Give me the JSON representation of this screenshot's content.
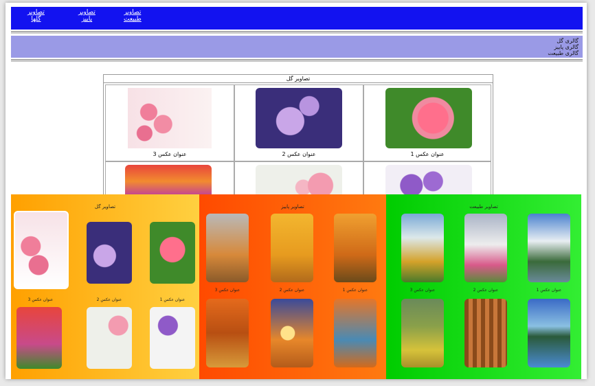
{
  "topnav": {
    "items": [
      {
        "line1": "تصاویر",
        "line2": "گلها"
      },
      {
        "line1": "تصاویر",
        "line2": "پاییز"
      },
      {
        "line1": "تصاویر",
        "line2": "طبیعت"
      }
    ]
  },
  "galleries": [
    "گالری گل",
    "گالری پاییز",
    "گالری طبیعت"
  ],
  "table": {
    "title": "تصاویر گل",
    "captions": [
      "عنوان عکس 1",
      "عنوان عکس 2",
      "عنوان عکس 3"
    ]
  },
  "panels": [
    {
      "title": "تصاویر گل",
      "captions": [
        "عنوان عکس 1",
        "عنوان عکس 2",
        "عنوان عکس 3"
      ]
    },
    {
      "title": "تصاویر پاییز",
      "captions": [
        "عنوان عکس 1",
        "عنوان عکس 2",
        "عنوان عکس 3"
      ]
    },
    {
      "title": "تصاویر طبیعت",
      "captions": [
        "عنوان عکس 1",
        "عنوان عکس 2",
        "عنوان عکس 3"
      ]
    }
  ],
  "colors": {
    "nav": "#1212f0",
    "gallery_bar": "#9a9ae6",
    "panel_flowers": "#ffaa00",
    "panel_autumn": "#ff5500",
    "panel_nature": "#11dd11"
  }
}
